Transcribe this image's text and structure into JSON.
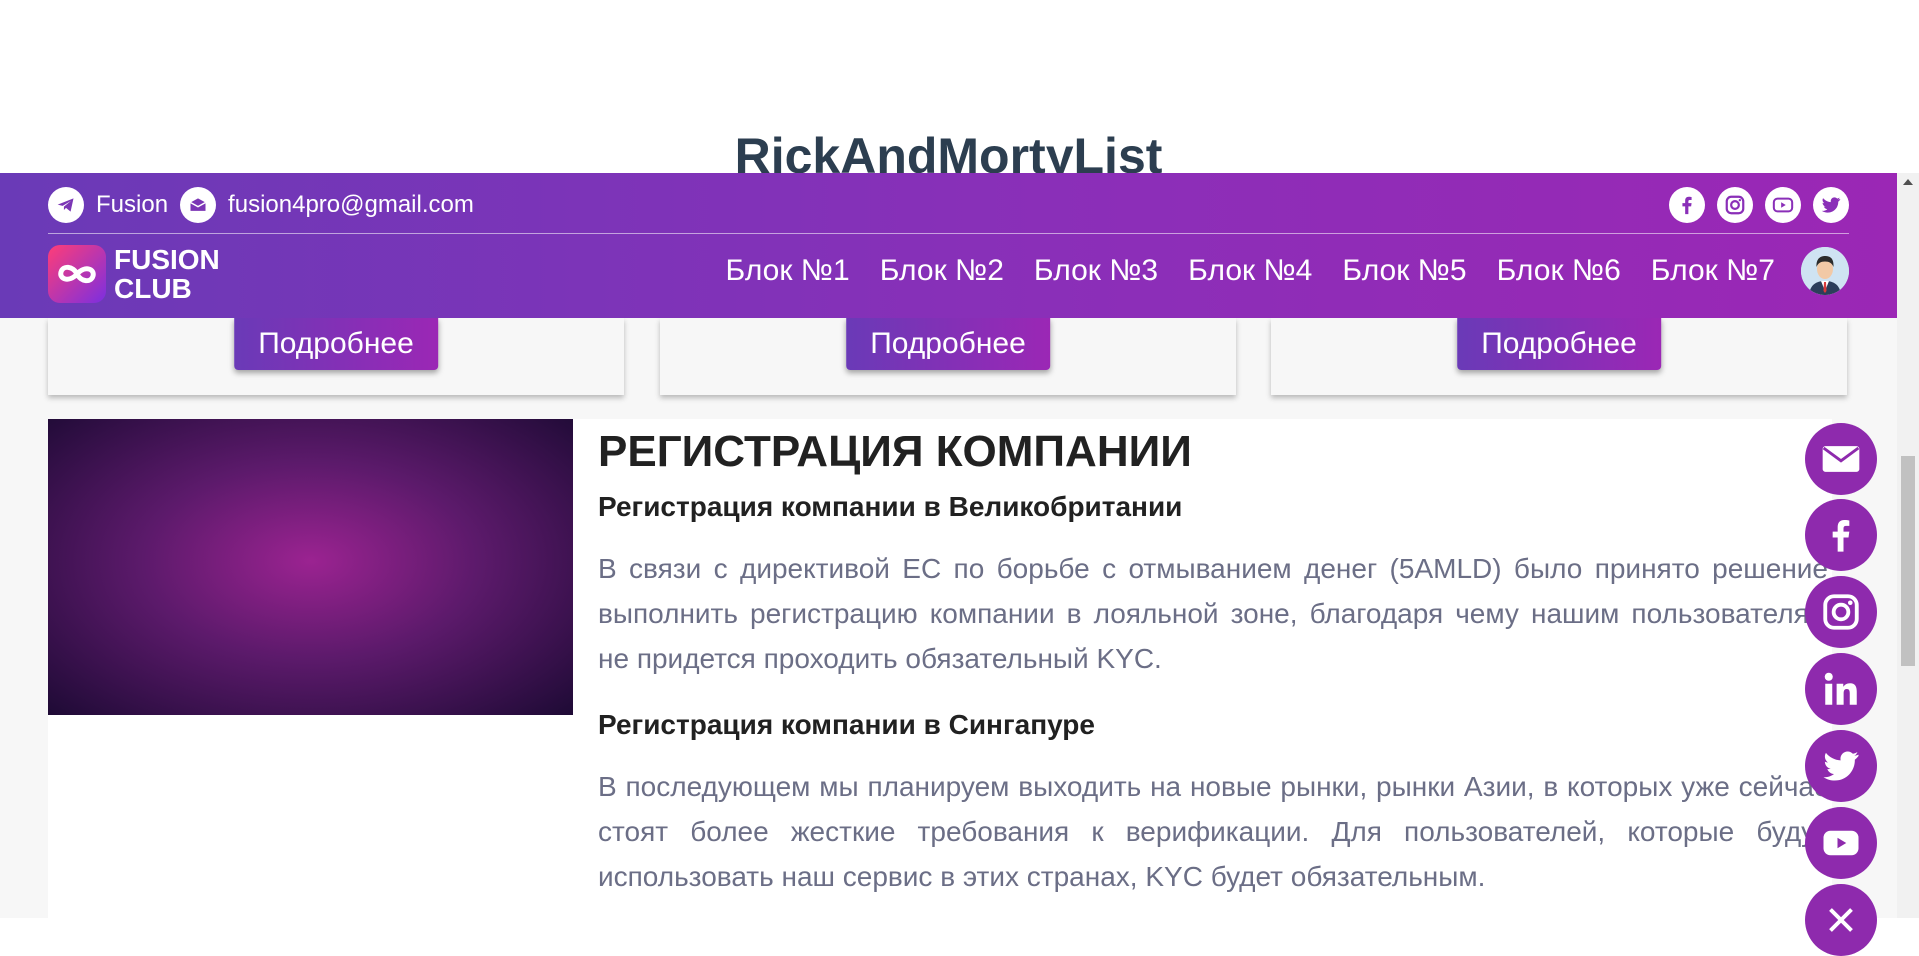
{
  "page_title": "RickAndMortyList",
  "topbar": {
    "telegram_label": "Fusion",
    "email_label": "fusion4pro@gmail.com",
    "social_icons": [
      "facebook-icon",
      "instagram-icon",
      "youtube-icon",
      "twitter-icon"
    ]
  },
  "logo": {
    "line1": "FUSION",
    "line2": "CLUB"
  },
  "nav": {
    "items": [
      "Блок №1",
      "Блок №2",
      "Блок №3",
      "Блок №4",
      "Блок №5",
      "Блок №6",
      "Блок №7"
    ]
  },
  "cards": [
    {
      "button_label": "Подробнее"
    },
    {
      "button_label": "Подробнее"
    },
    {
      "button_label": "Подробнее"
    }
  ],
  "article": {
    "heading": "РЕГИСТРАЦИЯ КОМПАНИИ",
    "sections": [
      {
        "subheading": "Регистрация компании в Великобритании",
        "text": "В связи с директивой ЕС по борьбе с отмыванием денег (5AMLD) было принято решение выполнить регистрацию компании в лояльной зоне, благодаря чему нашим пользователям не придется проходить обязательный KYC."
      },
      {
        "subheading": "Регистрация компании в Сингапуре",
        "text": "В последующем мы планируем выходить на новые рынки, рынки Азии, в которых уже сейчас стоят более жесткие требования к верификации. Для пользователей, которые будут использовать наш сервис в этих странах, KYC будет обязательным."
      }
    ]
  },
  "floating_social": [
    "email-icon",
    "facebook-icon",
    "instagram-icon",
    "linkedin-icon",
    "twitter-icon",
    "youtube-icon",
    "close-icon"
  ],
  "colors": {
    "header_gradient_start": "#6a3ab7",
    "header_gradient_end": "#9b27b5",
    "float_button": "#8e2aad",
    "body_text": "#6b6e86"
  }
}
